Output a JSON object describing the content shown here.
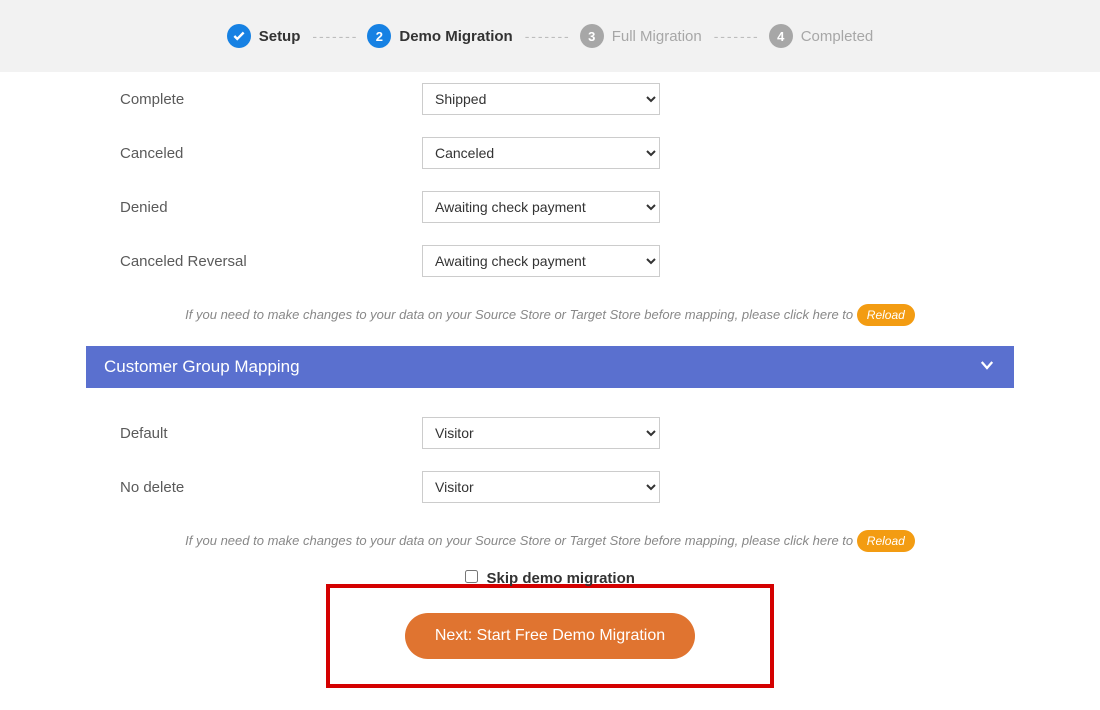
{
  "stepper": {
    "step1": {
      "label": "Setup"
    },
    "step2": {
      "num": "2",
      "label": "Demo Migration"
    },
    "step3": {
      "num": "3",
      "label": "Full Migration"
    },
    "step4": {
      "num": "4",
      "label": "Completed"
    }
  },
  "order_mapping": {
    "rows": [
      {
        "label": "Complete",
        "value": "Shipped"
      },
      {
        "label": "Canceled",
        "value": "Canceled"
      },
      {
        "label": "Denied",
        "value": "Awaiting check payment"
      },
      {
        "label": "Canceled Reversal",
        "value": "Awaiting check payment"
      }
    ]
  },
  "hint": {
    "text": "If you need to make changes to your data on your Source Store or Target Store before mapping, please click here to",
    "reload": "Reload"
  },
  "section": {
    "title": "Customer Group Mapping"
  },
  "customer_mapping": {
    "rows": [
      {
        "label": "Default",
        "value": "Visitor"
      },
      {
        "label": "No delete",
        "value": "Visitor"
      }
    ]
  },
  "skip": {
    "label": "Skip demo migration"
  },
  "cta": {
    "label": "Next: Start Free Demo Migration"
  }
}
